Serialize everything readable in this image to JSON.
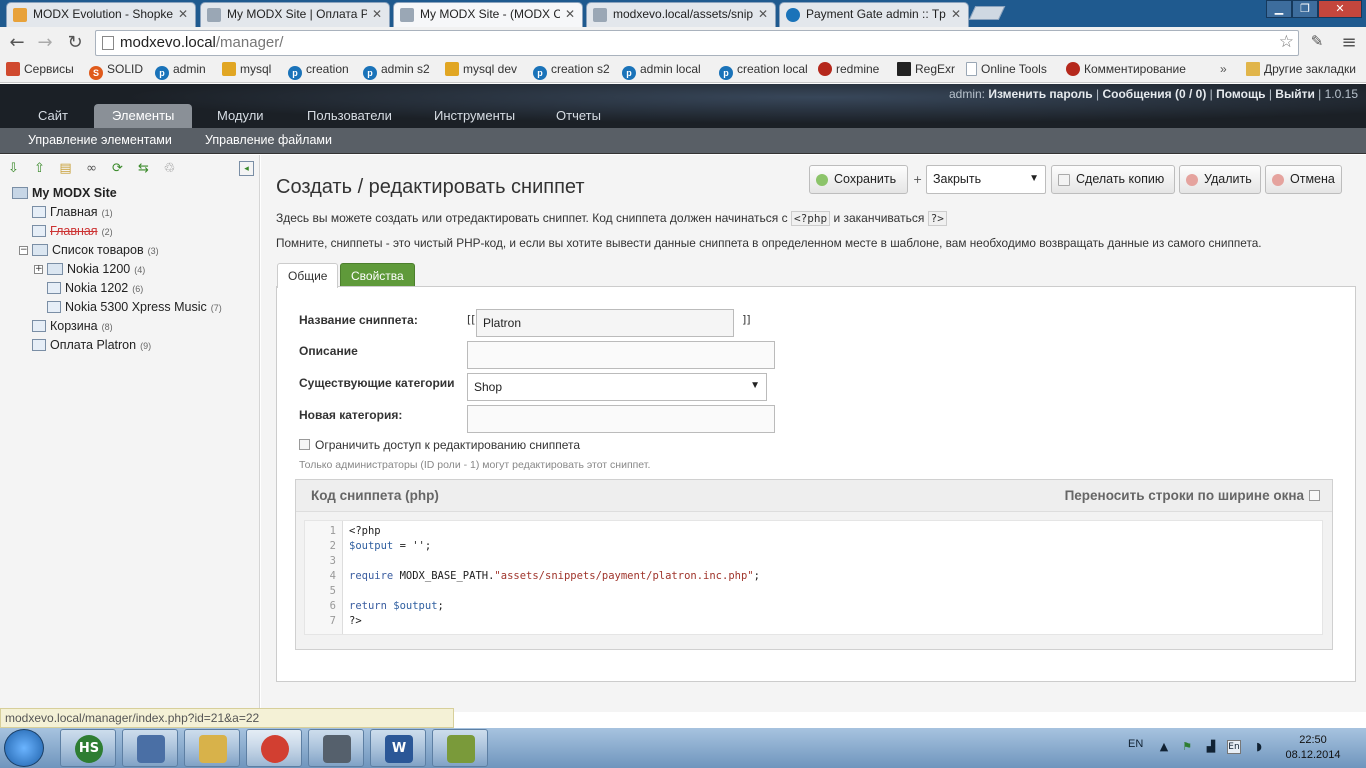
{
  "browser": {
    "tabs": [
      {
        "title": "MODX Evolution - Shopke",
        "favicon_color": "#e8a23a"
      },
      {
        "title": "My MODX Site | Оплата P",
        "favicon_color": "#9aa7b5"
      },
      {
        "title": "My MODX Site - (MODX C",
        "favicon_color": "#9aa7b5"
      },
      {
        "title": "modxevo.local/assets/snip",
        "favicon_color": "#9aa7b5"
      },
      {
        "title": "Payment Gate admin :: Tp",
        "favicon_color": "#1a73b9"
      }
    ],
    "url_host": "modxevo.local",
    "url_path": "/manager/",
    "bookmarks": [
      {
        "label": "Сервисы",
        "icon": "apps-icon",
        "color": "#d04a2f"
      },
      {
        "label": "SOLID",
        "icon": "solid-icon",
        "color": "#e05a1b"
      },
      {
        "label": "admin",
        "icon": "p-icon",
        "color": "#1a73b9"
      },
      {
        "label": "mysql",
        "icon": "pma-icon",
        "color": "#e1a623"
      },
      {
        "label": "creation",
        "icon": "p-icon",
        "color": "#1a73b9"
      },
      {
        "label": "admin s2",
        "icon": "p-icon",
        "color": "#1a73b9"
      },
      {
        "label": "mysql dev",
        "icon": "pma-icon",
        "color": "#e1a623"
      },
      {
        "label": "creation s2",
        "icon": "p-icon",
        "color": "#1a73b9"
      },
      {
        "label": "admin local",
        "icon": "p-icon",
        "color": "#1a73b9"
      },
      {
        "label": "creation local",
        "icon": "p-icon",
        "color": "#1a73b9"
      },
      {
        "label": "redmine",
        "icon": "redmine-icon",
        "color": "#b5281c"
      },
      {
        "label": "RegExr",
        "icon": "regexr-icon",
        "color": "#222222"
      },
      {
        "label": "Online Tools",
        "icon": "page-icon",
        "color": "#9aa7b5"
      },
      {
        "label": "Комментирование",
        "icon": "redmine-icon",
        "color": "#b5281c"
      }
    ],
    "bookmarks_overflow": "»",
    "other_bookmarks": "Другие закладки"
  },
  "modx": {
    "userbar": {
      "user": "admin:",
      "change_password": "Изменить пароль",
      "messages": "Сообщения (0 / 0)",
      "help": "Помощь",
      "logout": "Выйти",
      "version": "1.0.15"
    },
    "main_tabs": [
      "Сайт",
      "Элементы",
      "Модули",
      "Пользователи",
      "Инструменты",
      "Отчеты"
    ],
    "active_tab": "Элементы",
    "sub_nav": [
      "Управление элементами",
      "Управление файлами"
    ]
  },
  "tree": {
    "root": "My MODX Site",
    "nodes": [
      {
        "label": "Главная",
        "count": "(1)"
      },
      {
        "label": "Главная",
        "count": "(2)"
      },
      {
        "label": "Список товаров",
        "count": "(3)"
      },
      {
        "label": "Nokia 1200",
        "count": "(4)"
      },
      {
        "label": "Nokia 1202",
        "count": "(6)"
      },
      {
        "label": "Nokia 5300 Xpress Music",
        "count": "(7)"
      },
      {
        "label": "Корзина",
        "count": "(8)"
      },
      {
        "label": "Оплата Platron",
        "count": "(9)"
      }
    ]
  },
  "page": {
    "title": "Создать / редактировать сниппет",
    "actions": {
      "save": "Сохранить",
      "plus": "+",
      "close_select": "Закрыть",
      "copy": "Сделать копию",
      "delete": "Удалить",
      "cancel": "Отмена"
    },
    "intro1_a": "Здесь вы можете создать или отредактировать сниппет. Код сниппета должен начинаться с",
    "intro1_code1": "<?php",
    "intro1_b": "и заканчиваться",
    "intro1_code2": "?>",
    "intro2": "Помните, сниппеты - это чистый PHP-код, и если вы хотите вывести данные сниппета в определенном месте в шаблоне, вам необходимо возвращать данные из самого сниппета.",
    "tabs": {
      "general": "Общие",
      "properties": "Свойства"
    },
    "form": {
      "name_label": "Название сниппета:",
      "name_value": "Platron",
      "bracket_open": "[[",
      "bracket_close": "]]",
      "desc_label": "Описание",
      "desc_value": "",
      "category_label": "Существующие категории",
      "category_value": "Shop",
      "newcat_label": "Новая категория:",
      "newcat_value": "",
      "restrict_label": "Ограничить доступ к редактированию сниппета",
      "restrict_note": "Только администраторы (ID роли - 1) могут редактировать этот сниппет."
    },
    "code": {
      "title": "Код сниппета (php)",
      "wrap_label": "Переносить строки по ширине окна",
      "line_numbers": [
        "1",
        "2",
        "3",
        "4",
        "5",
        "6",
        "7"
      ],
      "l1": "<?php",
      "l2_var": "$output",
      "l2_rest": " = '';",
      "l4_kw": "require",
      "l4_const": " MODX_BASE_PATH.",
      "l4_str": "\"assets/snippets/payment/platron.inc.php\"",
      "l4_end": ";",
      "l6_kw": "return",
      "l6_var": " $output",
      "l6_end": ";",
      "l7": "?>"
    }
  },
  "status_url": "modxevo.local/manager/index.php?id=21&a=22",
  "taskbar": {
    "apps": [
      {
        "icon": "hs-icon",
        "label": "HS",
        "color": "#2e7d32"
      },
      {
        "icon": "virtualbox-icon",
        "label": "",
        "color": "#4a6fa5"
      },
      {
        "icon": "explorer-icon",
        "label": "",
        "color": "#d8b24a"
      },
      {
        "icon": "chrome-icon",
        "label": "",
        "color": "#d23f31"
      },
      {
        "icon": "keepass-icon",
        "label": "",
        "color": "#55606c"
      },
      {
        "icon": "word-icon",
        "label": "W",
        "color": "#2b5797"
      },
      {
        "icon": "chart-app-icon",
        "label": "",
        "color": "#7a9a3a"
      }
    ],
    "lang": "EN",
    "tray_lang": "En",
    "time": "22:50",
    "date": "08.12.2014"
  }
}
